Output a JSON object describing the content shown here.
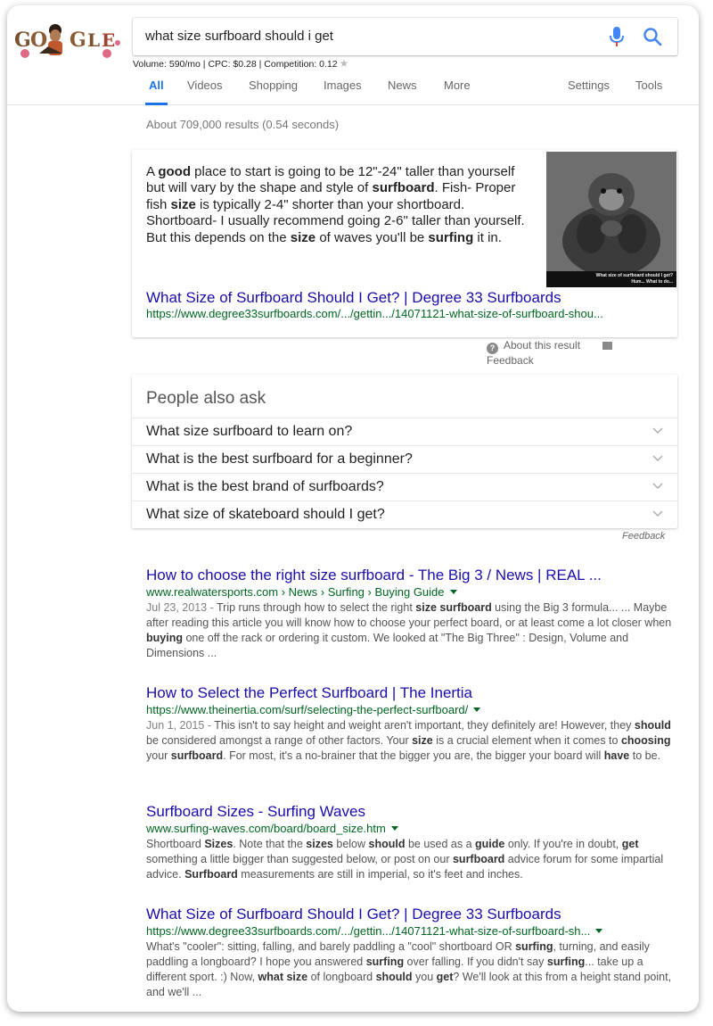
{
  "search": {
    "query": "what size surfboard should i get",
    "keyword_stats": "Volume: 590/mo | CPC: $0.28 | Competition: 0.12"
  },
  "tabs": [
    {
      "label": "All",
      "active": true
    },
    {
      "label": "Videos"
    },
    {
      "label": "Shopping"
    },
    {
      "label": "Images"
    },
    {
      "label": "News"
    },
    {
      "label": "More"
    },
    {
      "label": "Settings"
    },
    {
      "label": "Tools"
    }
  ],
  "result_stats": "About 709,000 results (0.54 seconds)",
  "featured_snippet": {
    "text_parts": [
      "A ",
      "good",
      " place to start is going to be 12\"-24\" taller than yourself but will vary by the shape and style of ",
      "surfboard",
      ". Fish- Proper fish ",
      "size",
      " is typically 2-4\" shorter than your shortboard. Shortboard- I usually recommend going 2-6\" taller than yourself. But this depends on the ",
      "size",
      " of waves you'll be ",
      "surfing",
      " it in."
    ],
    "title": "What Size of Surfboard Should I Get? | Degree 33 Surfboards",
    "url": "https://www.degree33surfboards.com/.../gettin.../14071121-what-size-of-surfboard-shou...",
    "image_caption_line1": "What size of surfboard should I get?",
    "image_caption_line2": "Hum... What to do...",
    "about_label": "About this result",
    "feedback_label": "Feedback"
  },
  "people_also_ask": {
    "title": "People also ask",
    "questions": [
      "What size surfboard to learn on?",
      "What is the best surfboard for a beginner?",
      "What is the best brand of surfboards?",
      "What size of skateboard should I get?"
    ],
    "feedback_label": "Feedback"
  },
  "results": [
    {
      "title": "How to choose the right size surfboard - The Big 3 / News | REAL ...",
      "url": "www.realwatersports.com › News › Surfing › Buying Guide",
      "date": "Jul 23, 2013 - ",
      "desc_parts": [
        "Trip runs through how to select the right ",
        "size surfboard",
        " using the Big 3 formula... ... Maybe after reading this article you will know how to choose your perfect board, or at least come a lot closer when ",
        "buying",
        " one off the rack or ordering it custom. We looked at \"The Big Three\" : Design, Volume and Dimensions ..."
      ]
    },
    {
      "title": "How to Select the Perfect Surfboard | The Inertia",
      "url": "https://www.theinertia.com/surf/selecting-the-perfect-surfboard/",
      "date": "Jun 1, 2015 - ",
      "desc_parts": [
        "This isn't to say height and weight aren't important, they definitely are! However, they ",
        "should",
        " be considered amongst a range of other factors. Your ",
        "size",
        " is a crucial element when it comes to ",
        "choosing",
        " your ",
        "surfboard",
        ". For most, it's a no-brainer that the bigger you are, the bigger your board will ",
        "have",
        " to be."
      ]
    },
    {
      "title": "Surfboard Sizes - Surfing Waves",
      "url": "www.surfing-waves.com/board/board_size.htm",
      "date": "",
      "desc_parts": [
        "Shortboard ",
        "Sizes",
        ". Note that the ",
        "sizes",
        " below ",
        "should",
        " be used as a ",
        "guide",
        " only. If you're in doubt, ",
        "get",
        " something a little bigger than suggested below, or post on our ",
        "surfboard",
        " advice forum for some impartial advice. ",
        "Surfboard",
        " measurements are still in imperial, so it's feet and inches."
      ]
    },
    {
      "title": "What Size of Surfboard Should I Get? | Degree 33 Surfboards",
      "url": "https://www.degree33surfboards.com/.../gettin.../14071121-what-size-of-surfboard-sh...",
      "date": "",
      "desc_parts": [
        "What's \"cooler\": sitting, falling, and barely paddling a \"cool\" shortboard OR ",
        "surfing",
        ", turning, and easily paddling a longboard? I hope you answered ",
        "surfing",
        " over falling. If you didn't say ",
        "surfing",
        "... take up a different sport. :) Now, ",
        "what size",
        " of longboard ",
        "should",
        " you ",
        "get",
        "? We'll look at this from a height stand point, and we'll ..."
      ]
    }
  ],
  "colors": {
    "link": "#1a0dab",
    "url_green": "#006621",
    "active_tab": "#1a73e8"
  }
}
